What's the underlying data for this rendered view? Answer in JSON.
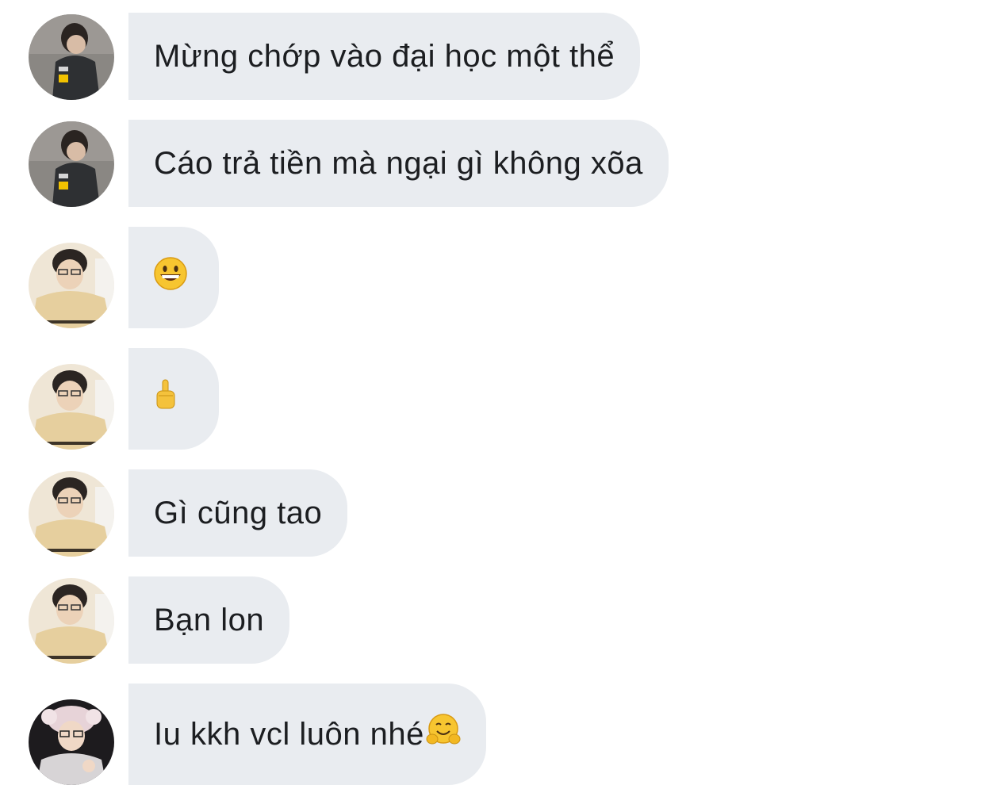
{
  "messages": [
    {
      "sender": "user-a",
      "text": "Mừng chớp vào đại học một thể"
    },
    {
      "sender": "user-a",
      "text": "Cáo trả tiền mà ngại gì không xõa"
    },
    {
      "sender": "user-b",
      "emoji": "grinning-face-emoji"
    },
    {
      "sender": "user-b",
      "emoji": "raised-finger-emoji"
    },
    {
      "sender": "user-b",
      "text": "Gì cũng tao"
    },
    {
      "sender": "user-b",
      "text": "Bạn lon"
    },
    {
      "sender": "user-c",
      "text": "Iu kkh vcl luôn nhé",
      "trailing_emoji": "hugging-face-emoji"
    }
  ],
  "colors": {
    "bubble_bg": "#e9ecf0",
    "text": "#1c1e21",
    "page_bg": "#ffffff"
  }
}
